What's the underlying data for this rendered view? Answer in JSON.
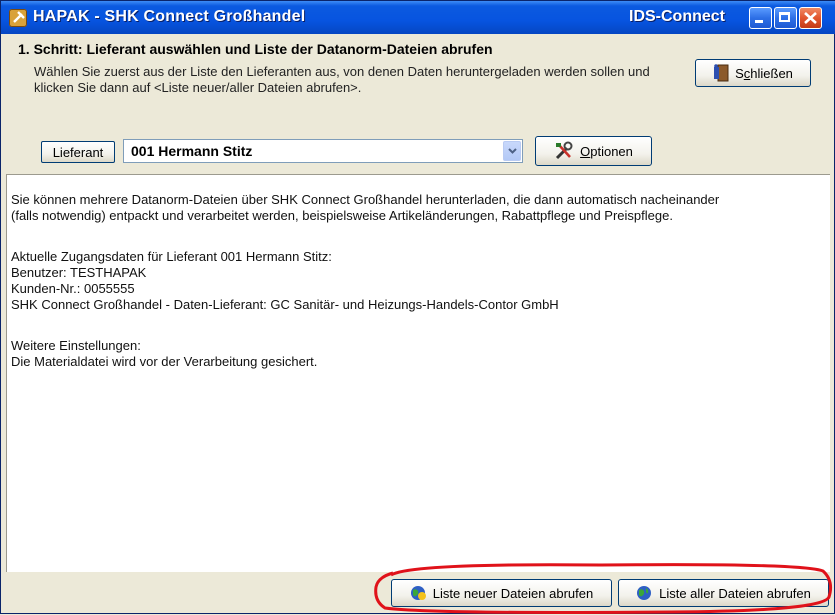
{
  "window": {
    "title": "HAPAK - SHK Connect Großhandel",
    "title_right": "IDS-Connect",
    "controls": {
      "minimize": "minimize-icon",
      "maximize": "maximize-icon",
      "close": "close-icon"
    }
  },
  "header": {
    "step_title": "1. Schritt: Lieferant auswählen und Liste der Datanorm-Dateien abrufen",
    "step_description": "Wählen Sie zuerst aus der Liste den Lieferanten aus, von denen Daten heruntergeladen werden sollen und klicken Sie dann auf <Liste neuer/aller Dateien abrufen>.",
    "close_button": {
      "pre": "S",
      "u": "c",
      "post": "hließen",
      "icon": "door-exit-icon"
    }
  },
  "supplier": {
    "label_button": "Lieferant",
    "selected": "001 Hermann Stitz",
    "options_button": {
      "u": "O",
      "post": "ptionen",
      "icon": "tools-icon"
    }
  },
  "content": {
    "intro": [
      "Sie können mehrere Datanorm-Dateien über SHK Connect Großhandel herunterladen, die dann automatisch nacheinander",
      "(falls notwendig) entpackt und verarbeitet werden, beispielsweise Artikeländerungen, Rabattpflege und Preispflege."
    ],
    "access": [
      "Aktuelle Zugangsdaten für Lieferant 001 Hermann Stitz:",
      "Benutzer: TESTHAPAK",
      "Kunden-Nr.: 0055555",
      "SHK Connect Großhandel - Daten-Lieferant: GC Sanitär- und Heizungs-Handels-Contor GmbH"
    ],
    "settings": [
      "Weitere Einstellungen:",
      "Die Materialdatei wird vor der Verarbeitung gesichert."
    ]
  },
  "footer": {
    "new_files_button": "Liste neuer Dateien abrufen",
    "all_files_button": "Liste aller Dateien abrufen",
    "highlight_color": "#e0121a"
  }
}
